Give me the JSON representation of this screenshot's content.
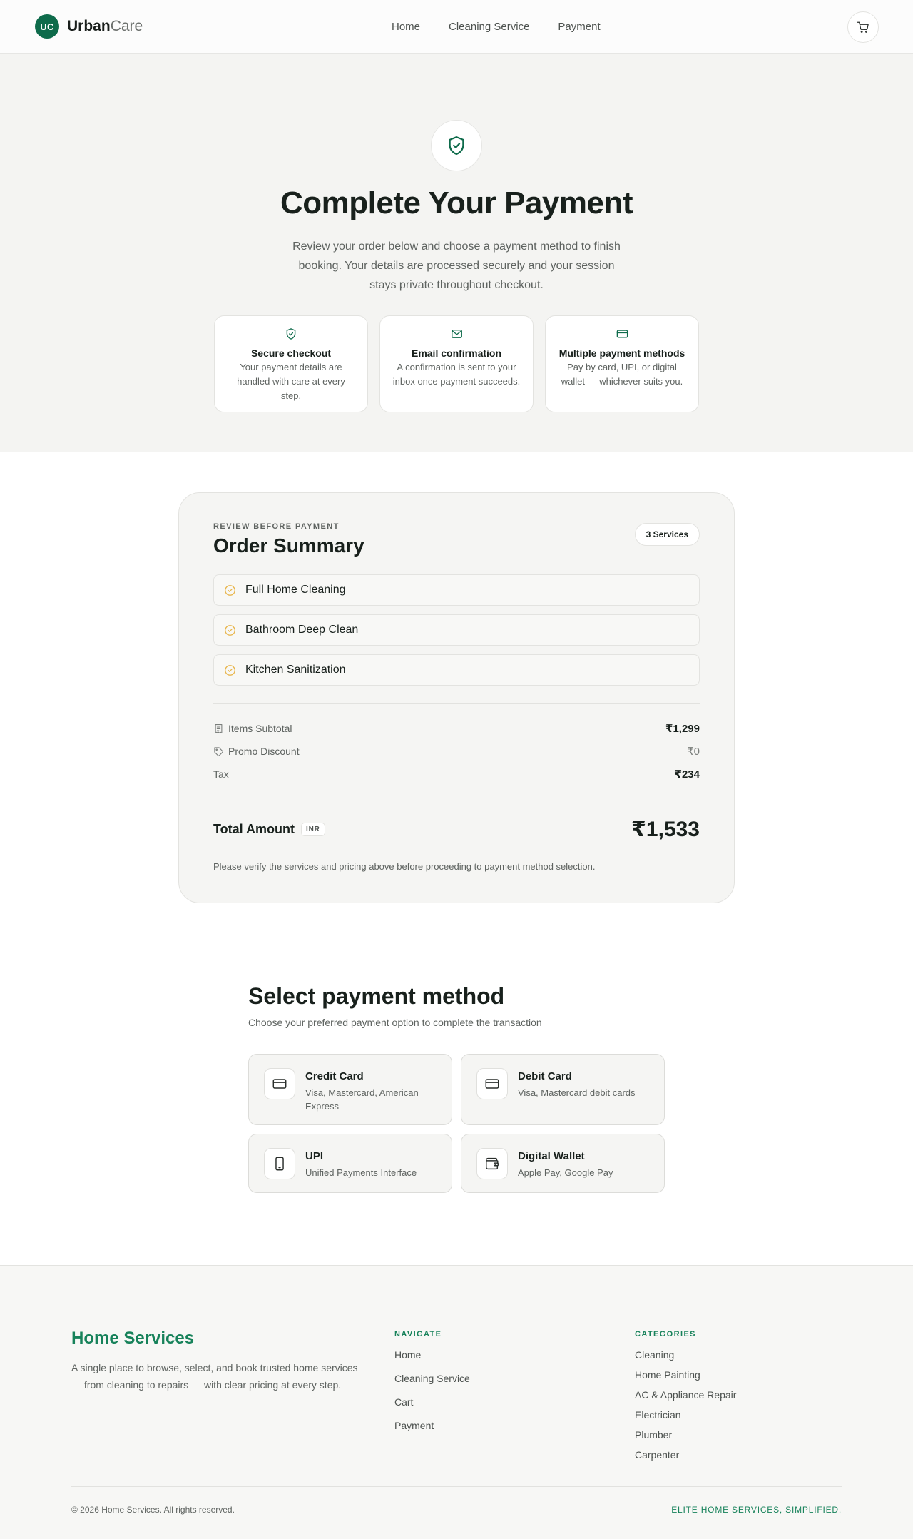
{
  "header": {
    "logo_badge": "UC",
    "brand_bold": "Urban",
    "brand_light": "Care",
    "nav": [
      "Home",
      "Cleaning Service",
      "Payment"
    ],
    "cart_icon": "cart-icon"
  },
  "hero": {
    "icon": "shield-check-icon",
    "title": "Complete Your Payment",
    "subtitle": "Review your order below and choose a payment method to finish booking. Your details are processed securely and your session stays private throughout checkout.",
    "features": [
      {
        "icon": "shield-check-icon",
        "title": "Secure checkout",
        "text": "Your payment details are handled with care at every step."
      },
      {
        "icon": "mail-icon",
        "title": "Email confirmation",
        "text": "A confirmation is sent to your inbox once payment succeeds."
      },
      {
        "icon": "credit-card-icon",
        "title": "Multiple payment methods",
        "text": "Pay by card, UPI, or digital wallet — whichever suits you."
      }
    ]
  },
  "summary": {
    "eyebrow": "REVIEW BEFORE PAYMENT",
    "title": "Order Summary",
    "count_badge": "3 Services",
    "services": [
      "Full Home Cleaning",
      "Bathroom Deep Clean",
      "Kitchen Sanitization"
    ],
    "lines": [
      {
        "label": "Items Subtotal",
        "value": "₹1,299",
        "icon": "receipt-icon"
      },
      {
        "label": "Promo Discount",
        "value": "₹0",
        "icon": "tag-icon"
      },
      {
        "label": "Tax",
        "value": "₹234"
      }
    ],
    "total_label": "Total Amount",
    "currency": "INR",
    "total_value": "₹1,533",
    "note": "Please verify the services and pricing above before proceeding to payment method selection."
  },
  "payment": {
    "title": "Select payment method",
    "subtitle": "Choose your preferred payment option to complete the transaction",
    "methods": [
      {
        "name": "Credit Card",
        "desc": "Visa, Mastercard, American Express",
        "icon": "credit-card-icon"
      },
      {
        "name": "Debit Card",
        "desc": "Visa, Mastercard debit cards",
        "icon": "credit-card-icon"
      },
      {
        "name": "UPI",
        "desc": "Unified Payments Interface",
        "icon": "smartphone-icon"
      },
      {
        "name": "Digital Wallet",
        "desc": "Apple Pay, Google Pay",
        "icon": "wallet-icon"
      }
    ]
  },
  "footer": {
    "brand": "Home Services",
    "description": "A single place to browse, select, and book trusted home services — from cleaning to repairs — with clear pricing at every step.",
    "navigate_heading": "NAVIGATE",
    "navigate": [
      "Home",
      "Cleaning Service",
      "Cart",
      "Payment"
    ],
    "categories_heading": "CATEGORIES",
    "categories": [
      "Cleaning",
      "Home Painting",
      "AC & Appliance Repair",
      "Electrician",
      "Plumber",
      "Carpenter"
    ],
    "copyright": "© 2026 Home Services. All rights reserved.",
    "tagline": "ELITE HOME SERVICES, SIMPLIFIED."
  },
  "colors": {
    "brand_green": "#0e6b4b",
    "accent_green": "#17825a",
    "check_amber": "#e8b54a"
  }
}
